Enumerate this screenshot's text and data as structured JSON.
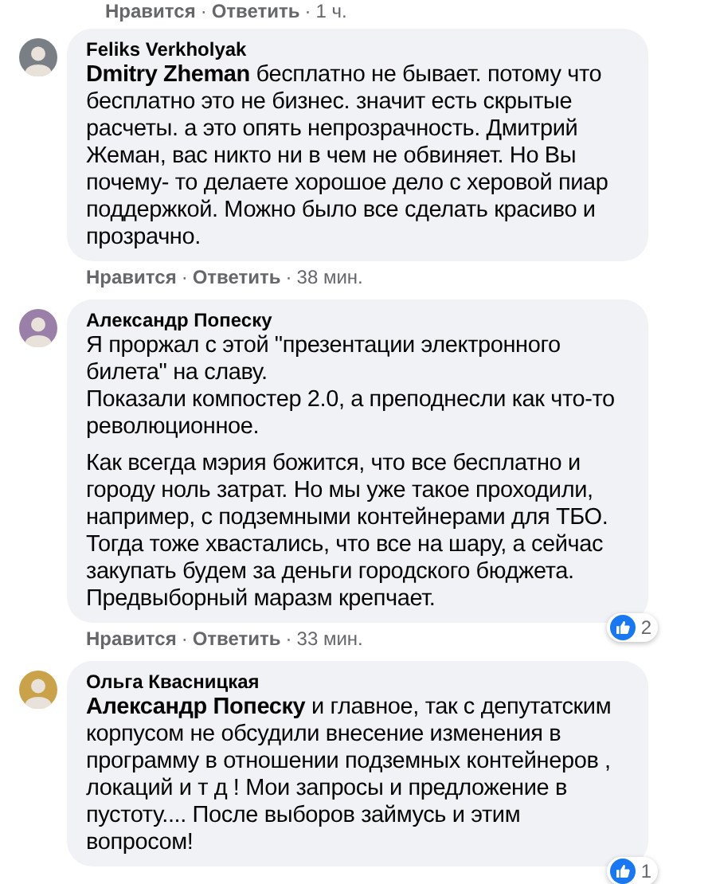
{
  "previous_footer": [
    {
      "kind": "link",
      "text": "Нравится"
    },
    {
      "kind": "dot",
      "text": "·"
    },
    {
      "kind": "link",
      "text": "Ответить"
    },
    {
      "kind": "dot",
      "text": "·"
    },
    {
      "kind": "time",
      "text": "1 ч."
    }
  ],
  "comments": [
    {
      "author": "Feliks Verkholyak",
      "paragraphs": [
        "**Dmitry Zheman** бесплатно не бывает. потому что бесплатно это не бизнес. значит есть скрытые расчеты. а это опять непрозрачность. Дмитрий Жеман, вас никто ни в чем не обвиняет. Но Вы почему- то делаете хорошое дело с херовой пиар поддержкой. Можно было все сделать красиво и прозрачно."
      ],
      "footer": [
        {
          "kind": "link",
          "text": "Нравится"
        },
        {
          "kind": "dot",
          "text": "·"
        },
        {
          "kind": "link",
          "text": "Ответить"
        },
        {
          "kind": "dot",
          "text": "·"
        },
        {
          "kind": "time",
          "text": "38 мин."
        }
      ]
    },
    {
      "author": "Александр Попеску",
      "paragraphs": [
        "Я проржал с этой \"презентации электронного билета\" на славу.\nПоказали компостер 2.0, а преподнесли как что-то революционное.",
        "Как всегда мэрия божится, что все бесплатно и городу ноль затрат. Но мы уже такое проходили, например, с подземными контейнерами для ТБО. Тогда тоже хвастались, что все на шару, а сейчас закупать будем за деньги городского бюджета. Предвыборный маразм крепчает."
      ],
      "reactions": "2",
      "footer": [
        {
          "kind": "link",
          "text": "Нравится"
        },
        {
          "kind": "dot",
          "text": "·"
        },
        {
          "kind": "link",
          "text": "Ответить"
        },
        {
          "kind": "dot",
          "text": "·"
        },
        {
          "kind": "time",
          "text": "33 мин."
        }
      ]
    },
    {
      "author": "Ольга Квасницкая",
      "paragraphs": [
        "**Александр Попеску** и главное, так с депутатским корпусом не обсудили внесение изменения в программу в отношении подземных контейнеров , локаций и т д ! Мои запросы и предложение в пустоту.... После выборов займусь и этим вопросом!"
      ],
      "reactions": "1"
    }
  ]
}
